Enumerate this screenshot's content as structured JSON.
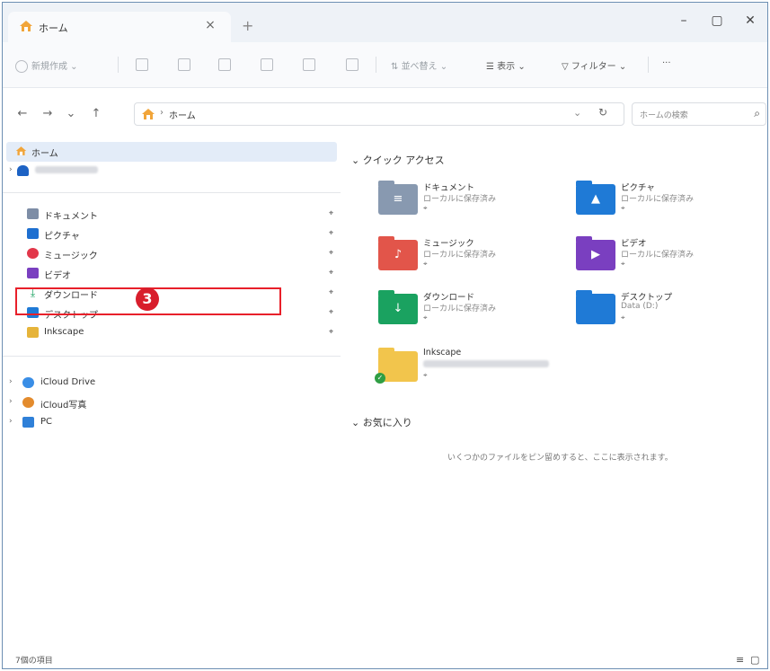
{
  "tab": {
    "title": "ホーム",
    "close": "×",
    "new": "+"
  },
  "window_controls": {
    "minimize": "–",
    "maximize": "▢",
    "close": "✕"
  },
  "command_bar": {
    "new": "新規作成",
    "sort": "並べ替え",
    "view": "表示",
    "filter": "フィルター",
    "more": "···"
  },
  "address": {
    "back": "←",
    "forward": "→",
    "recent": "⌄",
    "up": "↑",
    "separator": "›",
    "path": "ホーム",
    "dropdown": "⌄",
    "refresh": "↻",
    "search_placeholder": "ホームの検索",
    "search_icon": "⌕"
  },
  "sidebar": {
    "home": "ホーム",
    "quick": [
      {
        "label": "ドキュメント",
        "icon": "document-icon",
        "color": "#7d8da6"
      },
      {
        "label": "ピクチャ",
        "icon": "pictures-icon",
        "color": "#1e6fd0"
      },
      {
        "label": "ミュージック",
        "icon": "music-icon",
        "color": "#e2374a"
      },
      {
        "label": "ビデオ",
        "icon": "video-icon",
        "color": "#7a3fc0"
      },
      {
        "label": "ダウンロード",
        "icon": "download-icon",
        "color": "#1aa260"
      },
      {
        "label": "デスクトップ",
        "icon": "desktop-icon",
        "color": "#1f7ad6"
      },
      {
        "label": "Inkscape",
        "icon": "inkscape-icon",
        "color": "#e6b43a"
      }
    ],
    "drives": [
      {
        "label": "iCloud Drive",
        "icon": "icloud-drive-icon",
        "color": "#3a8ee6"
      },
      {
        "label": "iCloud写真",
        "icon": "icloud-photos-icon",
        "color": "#e38b2d"
      },
      {
        "label": "PC",
        "icon": "pc-icon",
        "color": "#2f80d8"
      }
    ],
    "pin": "⌖"
  },
  "annotation": {
    "step": "3"
  },
  "main": {
    "quick_access": "クイック アクセス",
    "favorites": "お気に入り",
    "favorites_empty": "いくつかのファイルをピン留めすると、ここに表示されます。",
    "tiles": [
      {
        "name": "ドキュメント",
        "sub": "ローカルに保存済み",
        "color": "#8899b0",
        "glyph": "≡"
      },
      {
        "name": "ピクチャ",
        "sub": "ローカルに保存済み",
        "color": "#1f7ad6",
        "glyph": "▲"
      },
      {
        "name": "ミュージック",
        "sub": "ローカルに保存済み",
        "color": "#e2554a",
        "glyph": "♪"
      },
      {
        "name": "ビデオ",
        "sub": "ローカルに保存済み",
        "color": "#7a3fc0",
        "glyph": "▶"
      },
      {
        "name": "ダウンロード",
        "sub": "ローカルに保存済み",
        "color": "#1aa260",
        "glyph": "↓"
      },
      {
        "name": "デスクトップ",
        "sub": "Data (D:)",
        "color": "#1f7ad6",
        "glyph": ""
      },
      {
        "name": "Inkscape",
        "sub": "",
        "color": "#f2c54c",
        "glyph": ""
      }
    ],
    "pin": "⌖"
  },
  "status": {
    "items": "7個の項目"
  }
}
